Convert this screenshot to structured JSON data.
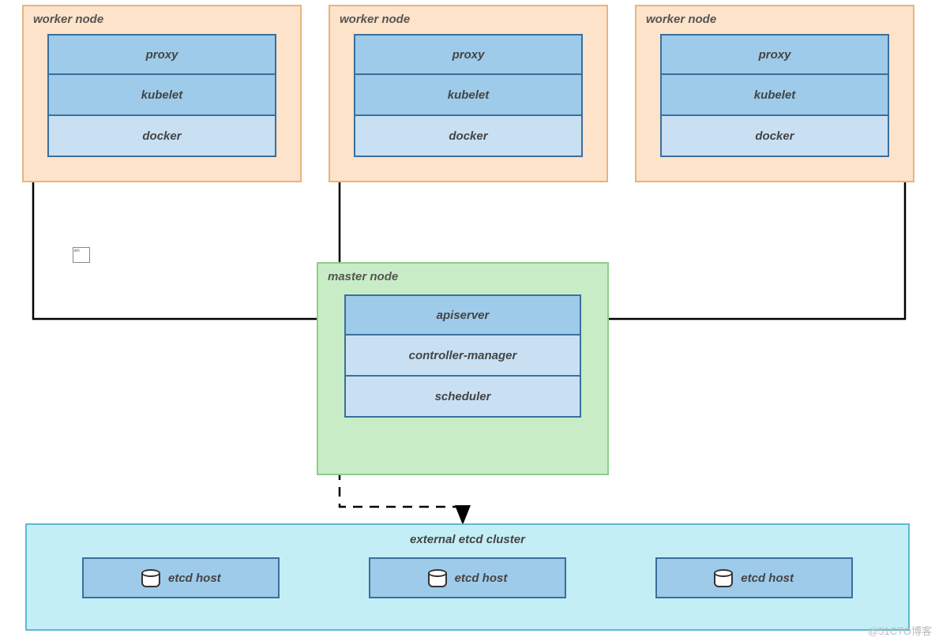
{
  "workers": [
    {
      "title": "worker node",
      "proxy": "proxy",
      "kubelet": "kubelet",
      "docker": "docker"
    },
    {
      "title": "worker node",
      "proxy": "proxy",
      "kubelet": "kubelet",
      "docker": "docker"
    },
    {
      "title": "worker node",
      "proxy": "proxy",
      "kubelet": "kubelet",
      "docker": "docker"
    }
  ],
  "master": {
    "title": "master node",
    "apiserver": "apiserver",
    "controller_manager": "controller-manager",
    "scheduler": "scheduler"
  },
  "etcd": {
    "title": "external etcd cluster",
    "hosts": [
      "etcd host",
      "etcd host",
      "etcd host"
    ]
  },
  "watermark": "@51CTO博客"
}
